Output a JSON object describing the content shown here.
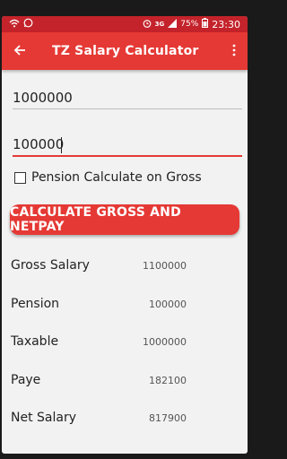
{
  "status_bar": {
    "time": "23:30",
    "battery": "75%",
    "network": "3G",
    "icons": [
      "wifi-hotspot-icon",
      "whatsapp-icon",
      "alarm-icon",
      "signal-icon",
      "battery-icon"
    ]
  },
  "app_bar": {
    "title": "TZ Salary Calculator",
    "back_icon": "back-arrow-icon",
    "menu_icon": "overflow-menu-icon"
  },
  "inputs": {
    "gross_value": "1000000",
    "pension_value": "100000"
  },
  "checkbox": {
    "label": "Pension Calculate on Gross",
    "checked": false
  },
  "button": {
    "label": "CALCULATE GROSS AND NETPAY"
  },
  "results": [
    {
      "label": "Gross Salary",
      "value": "1100000"
    },
    {
      "label": "Pension",
      "value": "100000"
    },
    {
      "label": "Taxable",
      "value": "1000000"
    },
    {
      "label": "Paye",
      "value": "182100"
    },
    {
      "label": "Net Salary",
      "value": "817900"
    }
  ],
  "colors": {
    "accent": "#e53935",
    "status_bar": "#c4232b",
    "background": "#f2f2f2"
  }
}
